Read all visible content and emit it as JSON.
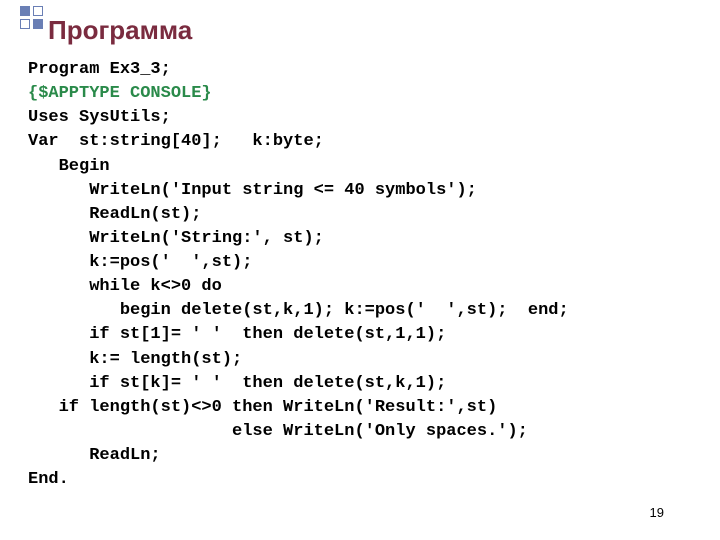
{
  "title": "Программа",
  "page_number": "19",
  "code": {
    "l01": "Program Ex3_3;",
    "l02": "{$APPTYPE CONSOLE}",
    "l03": "Uses SysUtils;",
    "l04": "Var  st:string[40];   k:byte;",
    "l05": "   Begin",
    "l06": "      WriteLn('Input string <= 40 symbols');",
    "l07": "      ReadLn(st);",
    "l08": "      WriteLn('String:', st);",
    "l09": "      k:=pos('  ',st);",
    "l10": "      while k<>0 do",
    "l11": "         begin delete(st,k,1); k:=pos('  ',st);  end;",
    "l12": "      if st[1]= ' '  then delete(st,1,1);",
    "l13": "      k:= length(st);",
    "l14": "      if st[k]= ' '  then delete(st,k,1);",
    "l15": "   if length(st)<>0 then WriteLn('Result:',st)",
    "l16": "                    else WriteLn('Only spaces.');",
    "l17": "      ReadLn;",
    "l18": "End."
  }
}
